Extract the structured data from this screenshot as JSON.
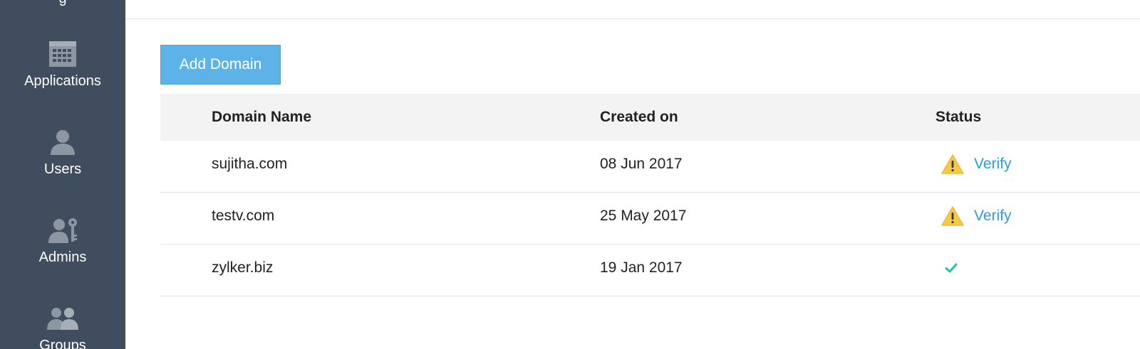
{
  "sidebar": {
    "top_partial_label": "g",
    "items": [
      {
        "label": "Applications",
        "icon": "applications-grid-icon"
      },
      {
        "label": "Users",
        "icon": "user-icon"
      },
      {
        "label": "Admins",
        "icon": "admin-key-icon"
      },
      {
        "label": "Groups",
        "icon": "groups-icon"
      }
    ]
  },
  "toolbar": {
    "add_domain_label": "Add Domain"
  },
  "table": {
    "columns": [
      "Domain Name",
      "Created on",
      "Status"
    ],
    "rows": [
      {
        "domain": "sujitha.com",
        "created": "08 Jun 2017",
        "status": "Verify",
        "status_icon": "warning-icon"
      },
      {
        "domain": "testv.com",
        "created": "25 May 2017",
        "status": "Verify",
        "status_icon": "warning-icon"
      },
      {
        "domain": "zylker.biz",
        "created": "19 Jan 2017",
        "status": "",
        "status_icon": "check-icon"
      }
    ]
  },
  "colors": {
    "sidebar_bg": "#3f4d5e",
    "accent": "#5db3e7",
    "link": "#2a9fe0",
    "warning": "#f7c948",
    "success": "#1fc6a6"
  }
}
